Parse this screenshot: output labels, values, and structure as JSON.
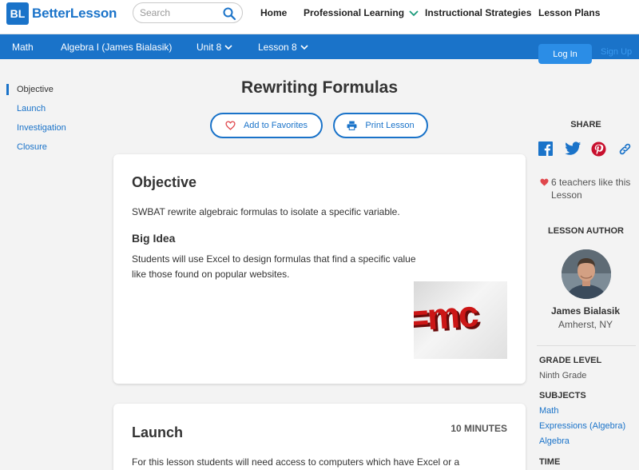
{
  "header": {
    "logo_mark": "BL",
    "logo_text": "BetterLesson",
    "search_placeholder": "Search",
    "nav": [
      "Home",
      "Professional Learning",
      "Instructional Strategies",
      "Lesson Plans"
    ]
  },
  "breadcrumb": {
    "items": [
      "Math",
      "Algebra I (James Bialasik)",
      "Unit 8",
      "Lesson 8"
    ],
    "login_label": "Log In",
    "signup_label": "Sign Up"
  },
  "leftnav": {
    "items": [
      "Objective",
      "Launch",
      "Investigation",
      "Closure"
    ],
    "active": "Objective"
  },
  "lesson": {
    "title": "Rewriting Formulas",
    "add_favorites_label": "Add to Favorites",
    "print_label": "Print Lesson"
  },
  "objective_card": {
    "heading": "Objective",
    "text": "SWBAT rewrite algebraic formulas to isolate a specific variable.",
    "big_idea_heading": "Big Idea",
    "big_idea_text": "Students will use Excel to design formulas that find a specific value like those found on popular websites.",
    "image_text": "=mc"
  },
  "launch_card": {
    "heading": "Launch",
    "minutes": "10 MINUTES",
    "text": "For this lesson students will need access to computers which have Excel or a"
  },
  "sidebar": {
    "share_heading": "SHARE",
    "share_icons": [
      "facebook-icon",
      "twitter-icon",
      "pinterest-icon",
      "link-icon"
    ],
    "likes_text": "6 teachers like this Lesson",
    "author_heading": "LESSON AUTHOR",
    "author_name": "James Bialasik",
    "author_location": "Amherst, NY",
    "grade_heading": "GRADE LEVEL",
    "grade_value": "Ninth Grade",
    "subjects_heading": "SUBJECTS",
    "subjects": [
      "Math",
      "Expressions (Algebra)",
      "Algebra"
    ],
    "time_heading": "TIME"
  },
  "colors": {
    "brand_blue": "#1a73c9",
    "heart_red": "#e0474c"
  }
}
